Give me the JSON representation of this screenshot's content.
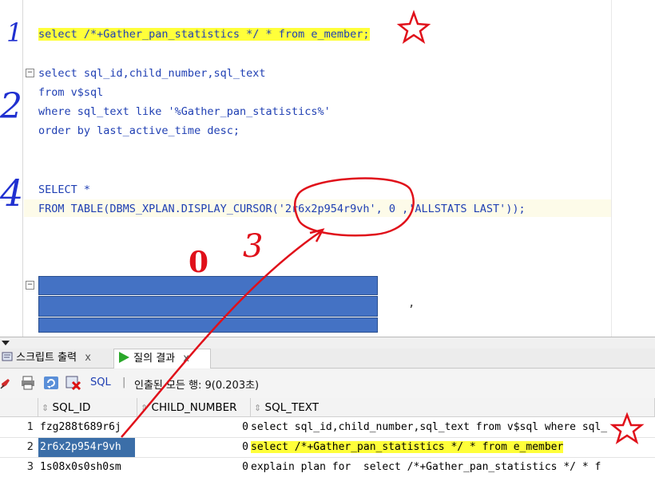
{
  "editor": {
    "line1": "select /*+Gather_pan_statistics */ * from e_member;",
    "q2": [
      "select sql_id,child_number,sql_text",
      "from v$sql",
      "where sql_text like '%Gather_pan_statistics%'",
      "order by last_active_time desc;"
    ],
    "q3_line1": "SELECT *",
    "q3_line2_a": "FROM TABLE(DBMS_XPLAN.DISPLAY_CURSOR(",
    "q3_line2_b": "'2r6x2p954r9vh'",
    "q3_line2_c": ", 0 ,'ALLSTATS LAST'));",
    "fold_icon": "−"
  },
  "annotations": {
    "n1": "1",
    "n2": "2",
    "n3": "3",
    "n4": "4",
    "n0": "0",
    "comma": ","
  },
  "tabs": [
    {
      "label": "스크립트 출력",
      "close": "x",
      "icon": "script-output-icon"
    },
    {
      "label": "질의 결과",
      "close": "x",
      "icon": "run-icon"
    }
  ],
  "toolbar": {
    "sql_label": "SQL",
    "separator": "|",
    "fetched_text": "인출된 모든 행: 9(0.203초)"
  },
  "grid": {
    "columns": [
      "SQL_ID",
      "CHILD_NUMBER",
      "SQL_TEXT"
    ],
    "rows": [
      {
        "num": "1",
        "sql_id": "fzg288t689r6j",
        "child": "0",
        "text": "select sql_id,child_number,sql_text from v$sql where sql_"
      },
      {
        "num": "2",
        "sql_id": "2r6x2p954r9vh",
        "child": "0",
        "text": "select /*+Gather_pan_statistics */ * from e_member"
      },
      {
        "num": "3",
        "sql_id": "1s08x0s0sh0sm",
        "child": "0",
        "text": "explain plan for  select /*+Gather_pan_statistics */ * f"
      }
    ]
  },
  "colors": {
    "keyword": "#1f3fb3",
    "highlight": "#ffff3a",
    "annotation_red": "#e0101a",
    "annotation_blue": "#2030d0",
    "selection": "#3b6ea8"
  }
}
